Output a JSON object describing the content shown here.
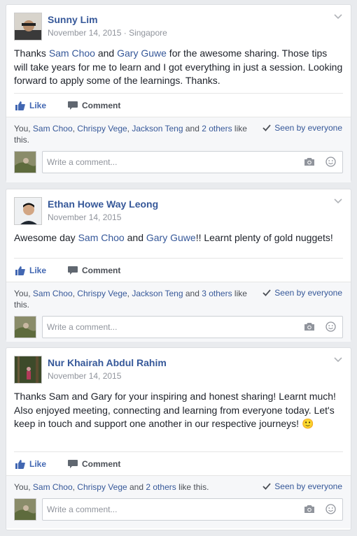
{
  "posts": [
    {
      "author": "Sunny Lim",
      "date": "November 14, 2015",
      "location": "Singapore",
      "body": {
        "p1": "Thanks ",
        "l1": "Sam Choo",
        "p2": " and ",
        "l2": "Gary Guwe",
        "p3": " for the awesome sharing. Those tips will take years for me to learn and I got everything in just a session. Looking forward to apply some of the learnings. Thanks."
      },
      "like_label": "Like",
      "comment_label": "Comment",
      "likes": {
        "prefix": "You, ",
        "n1": "Sam Choo",
        "n2": "Chrispy Vege",
        "n3": "Jackson Teng",
        "and": " and ",
        "others": "2 others",
        "suffix": " like this."
      },
      "seen": "Seen by everyone",
      "comment_placeholder": "Write a comment..."
    },
    {
      "author": "Ethan Howe Way Leong",
      "date": "November 14, 2015",
      "body": {
        "p1": "Awesome day ",
        "l1": "Sam Choo",
        "p2": " and ",
        "l2": "Gary Guwe",
        "p3": "!! Learnt plenty of gold nuggets!"
      },
      "like_label": "Like",
      "comment_label": "Comment",
      "likes": {
        "prefix": "You, ",
        "n1": "Sam Choo",
        "n2": "Chrispy Vege",
        "n3": "Jackson Teng",
        "and": " and ",
        "others": "3 others",
        "suffix": " like this."
      },
      "seen": "Seen by everyone",
      "comment_placeholder": "Write a comment..."
    },
    {
      "author": "Nur Khairah Abdul Rahim",
      "date": "November 14, 2015",
      "body": {
        "text": "Thanks Sam and Gary for your inspiring and honest sharing! Learnt much! Also enjoyed meeting, connecting and learning from everyone today. Let's keep in touch and support one another in our respective journeys! ",
        "emoji": "🙂"
      },
      "like_label": "Like",
      "comment_label": "Comment",
      "likes": {
        "prefix": "You, ",
        "n1": "Sam Choo",
        "n2": "Chrispy Vege",
        "and": " and ",
        "others": "2 others",
        "suffix": " like this."
      },
      "seen": "Seen by everyone",
      "comment_placeholder": "Write a comment..."
    }
  ],
  "icons": {
    "like": "thumbs-up-icon",
    "comment": "speech-bubble-icon",
    "seen": "checkmark-icon",
    "camera": "camera-icon",
    "emoji": "smiley-icon",
    "menu": "chevron-down-icon"
  },
  "colors": {
    "link": "#365899",
    "like_blue": "#4267b2",
    "meta_gray": "#90949c",
    "background": "#e9ebee"
  }
}
